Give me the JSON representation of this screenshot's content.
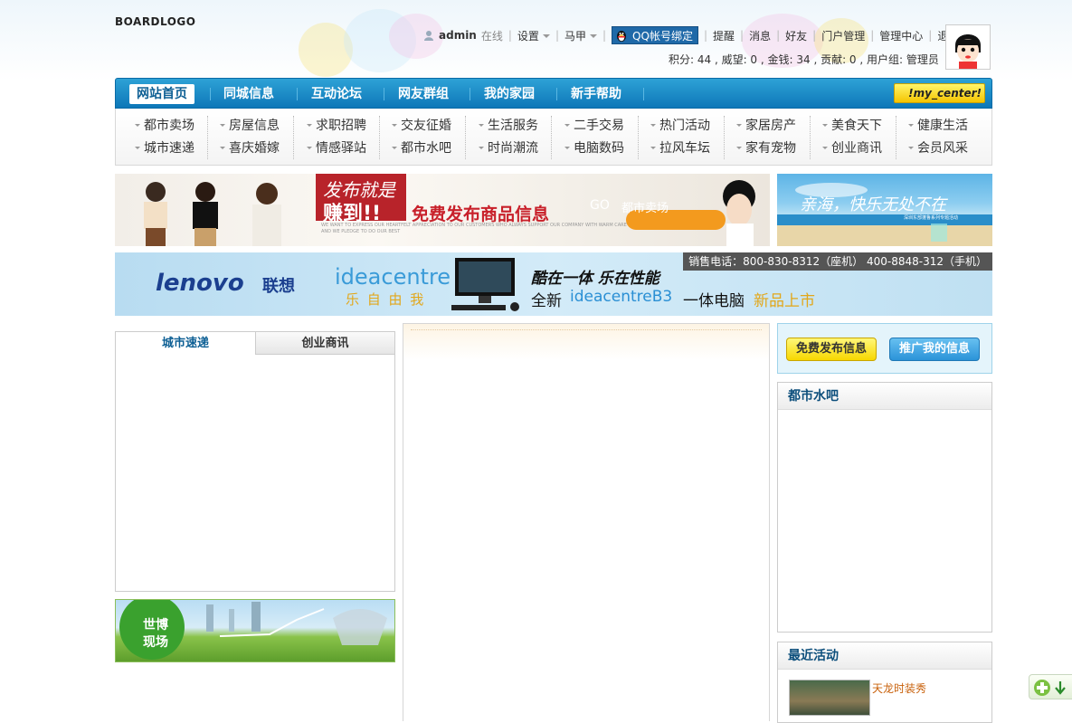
{
  "header": {
    "logo_text": "BOARDLOGO",
    "username": "admin",
    "online_status": "在线",
    "settings_label": "设置",
    "vest_label": "马甲",
    "qq_bind_label": "QQ帐号绑定",
    "links": [
      "提醒",
      "消息",
      "好友",
      "门户管理",
      "管理中心",
      "退出"
    ],
    "stats": "积分: 44 , 威望: 0 , 金钱: 34 , 贡献: 0 , 用户组: 管理员"
  },
  "nav": {
    "items": [
      "网站首页",
      "同城信息",
      "互动论坛",
      "网友群组",
      "我的家园",
      "新手帮助"
    ],
    "active_index": 0,
    "my_center_label": "!my_center!"
  },
  "subnav": {
    "columns": [
      [
        "都市卖场",
        "城市速递"
      ],
      [
        "房屋信息",
        "喜庆婚嫁"
      ],
      [
        "求职招聘",
        "情感驿站"
      ],
      [
        "交友征婚",
        "都市水吧"
      ],
      [
        "生活服务",
        "时尚潮流"
      ],
      [
        "二手交易",
        "电脑数码"
      ],
      [
        "热门活动",
        "拉风车坛"
      ],
      [
        "家居房产",
        "家有宠物"
      ],
      [
        "美食天下",
        "创业商讯"
      ],
      [
        "健康生活",
        "会员风采"
      ]
    ]
  },
  "banners": {
    "banner1_title": "发布就是",
    "banner1_hit": "赚到!!",
    "banner1_slogan": "免费发布商品信息",
    "banner1_go": "GO",
    "banner1_target": "都市卖场",
    "banner1_small": "WE WANT TO EXPRESS OUR HEARTFELT APPRECIATION TO OUR CUSTOMERS WHO ALWAYS SUPPORT OUR COMPANY WITH WARM CARE AND WE PLEDGE TO DO OUR BEST",
    "banner2_text": "亲海，快乐无处不在",
    "banner2_small": "深圳东部蓬鲁系列专题活动",
    "banner3_sales": "销售电话：800-830-8312（座机） 400-8848-312（手机）",
    "banner3_brand": "lenovo",
    "banner3_brand_cn": "联想",
    "banner3_idea": "ideacentre",
    "banner3_idea_sub": "乐 自 由 我",
    "banner3_headline": "酷在一体 乐在性能",
    "banner3_product_prefix": "全新",
    "banner3_product": "ideacentreB3",
    "banner3_product_suffix": "一体电脑",
    "banner3_new": "新品上市"
  },
  "left": {
    "tabs": [
      "城市速递",
      "创业商讯"
    ],
    "expo_label_1": "世博",
    "expo_label_2": "现场"
  },
  "right": {
    "free_post_label": "免费发布信息",
    "promote_label": "推广我的信息",
    "water_bar_title": "都市水吧",
    "events_title": "最近活动",
    "event_item": "天龙时装秀"
  },
  "colors": {
    "nav_blue": "#0d77b8",
    "link_orange": "#c8600a",
    "title_blue": "#0d4f7c"
  }
}
